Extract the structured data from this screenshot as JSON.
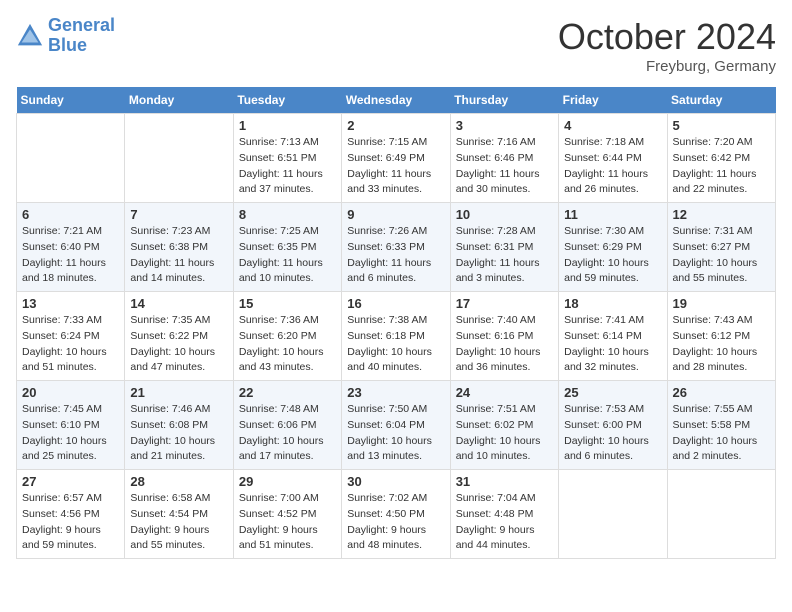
{
  "header": {
    "logo_line1": "General",
    "logo_line2": "Blue",
    "month": "October 2024",
    "location": "Freyburg, Germany"
  },
  "days_of_week": [
    "Sunday",
    "Monday",
    "Tuesday",
    "Wednesday",
    "Thursday",
    "Friday",
    "Saturday"
  ],
  "weeks": [
    [
      {
        "day": "",
        "info": ""
      },
      {
        "day": "",
        "info": ""
      },
      {
        "day": "1",
        "info": "Sunrise: 7:13 AM\nSunset: 6:51 PM\nDaylight: 11 hours and 37 minutes."
      },
      {
        "day": "2",
        "info": "Sunrise: 7:15 AM\nSunset: 6:49 PM\nDaylight: 11 hours and 33 minutes."
      },
      {
        "day": "3",
        "info": "Sunrise: 7:16 AM\nSunset: 6:46 PM\nDaylight: 11 hours and 30 minutes."
      },
      {
        "day": "4",
        "info": "Sunrise: 7:18 AM\nSunset: 6:44 PM\nDaylight: 11 hours and 26 minutes."
      },
      {
        "day": "5",
        "info": "Sunrise: 7:20 AM\nSunset: 6:42 PM\nDaylight: 11 hours and 22 minutes."
      }
    ],
    [
      {
        "day": "6",
        "info": "Sunrise: 7:21 AM\nSunset: 6:40 PM\nDaylight: 11 hours and 18 minutes."
      },
      {
        "day": "7",
        "info": "Sunrise: 7:23 AM\nSunset: 6:38 PM\nDaylight: 11 hours and 14 minutes."
      },
      {
        "day": "8",
        "info": "Sunrise: 7:25 AM\nSunset: 6:35 PM\nDaylight: 11 hours and 10 minutes."
      },
      {
        "day": "9",
        "info": "Sunrise: 7:26 AM\nSunset: 6:33 PM\nDaylight: 11 hours and 6 minutes."
      },
      {
        "day": "10",
        "info": "Sunrise: 7:28 AM\nSunset: 6:31 PM\nDaylight: 11 hours and 3 minutes."
      },
      {
        "day": "11",
        "info": "Sunrise: 7:30 AM\nSunset: 6:29 PM\nDaylight: 10 hours and 59 minutes."
      },
      {
        "day": "12",
        "info": "Sunrise: 7:31 AM\nSunset: 6:27 PM\nDaylight: 10 hours and 55 minutes."
      }
    ],
    [
      {
        "day": "13",
        "info": "Sunrise: 7:33 AM\nSunset: 6:24 PM\nDaylight: 10 hours and 51 minutes."
      },
      {
        "day": "14",
        "info": "Sunrise: 7:35 AM\nSunset: 6:22 PM\nDaylight: 10 hours and 47 minutes."
      },
      {
        "day": "15",
        "info": "Sunrise: 7:36 AM\nSunset: 6:20 PM\nDaylight: 10 hours and 43 minutes."
      },
      {
        "day": "16",
        "info": "Sunrise: 7:38 AM\nSunset: 6:18 PM\nDaylight: 10 hours and 40 minutes."
      },
      {
        "day": "17",
        "info": "Sunrise: 7:40 AM\nSunset: 6:16 PM\nDaylight: 10 hours and 36 minutes."
      },
      {
        "day": "18",
        "info": "Sunrise: 7:41 AM\nSunset: 6:14 PM\nDaylight: 10 hours and 32 minutes."
      },
      {
        "day": "19",
        "info": "Sunrise: 7:43 AM\nSunset: 6:12 PM\nDaylight: 10 hours and 28 minutes."
      }
    ],
    [
      {
        "day": "20",
        "info": "Sunrise: 7:45 AM\nSunset: 6:10 PM\nDaylight: 10 hours and 25 minutes."
      },
      {
        "day": "21",
        "info": "Sunrise: 7:46 AM\nSunset: 6:08 PM\nDaylight: 10 hours and 21 minutes."
      },
      {
        "day": "22",
        "info": "Sunrise: 7:48 AM\nSunset: 6:06 PM\nDaylight: 10 hours and 17 minutes."
      },
      {
        "day": "23",
        "info": "Sunrise: 7:50 AM\nSunset: 6:04 PM\nDaylight: 10 hours and 13 minutes."
      },
      {
        "day": "24",
        "info": "Sunrise: 7:51 AM\nSunset: 6:02 PM\nDaylight: 10 hours and 10 minutes."
      },
      {
        "day": "25",
        "info": "Sunrise: 7:53 AM\nSunset: 6:00 PM\nDaylight: 10 hours and 6 minutes."
      },
      {
        "day": "26",
        "info": "Sunrise: 7:55 AM\nSunset: 5:58 PM\nDaylight: 10 hours and 2 minutes."
      }
    ],
    [
      {
        "day": "27",
        "info": "Sunrise: 6:57 AM\nSunset: 4:56 PM\nDaylight: 9 hours and 59 minutes."
      },
      {
        "day": "28",
        "info": "Sunrise: 6:58 AM\nSunset: 4:54 PM\nDaylight: 9 hours and 55 minutes."
      },
      {
        "day": "29",
        "info": "Sunrise: 7:00 AM\nSunset: 4:52 PM\nDaylight: 9 hours and 51 minutes."
      },
      {
        "day": "30",
        "info": "Sunrise: 7:02 AM\nSunset: 4:50 PM\nDaylight: 9 hours and 48 minutes."
      },
      {
        "day": "31",
        "info": "Sunrise: 7:04 AM\nSunset: 4:48 PM\nDaylight: 9 hours and 44 minutes."
      },
      {
        "day": "",
        "info": ""
      },
      {
        "day": "",
        "info": ""
      }
    ]
  ]
}
